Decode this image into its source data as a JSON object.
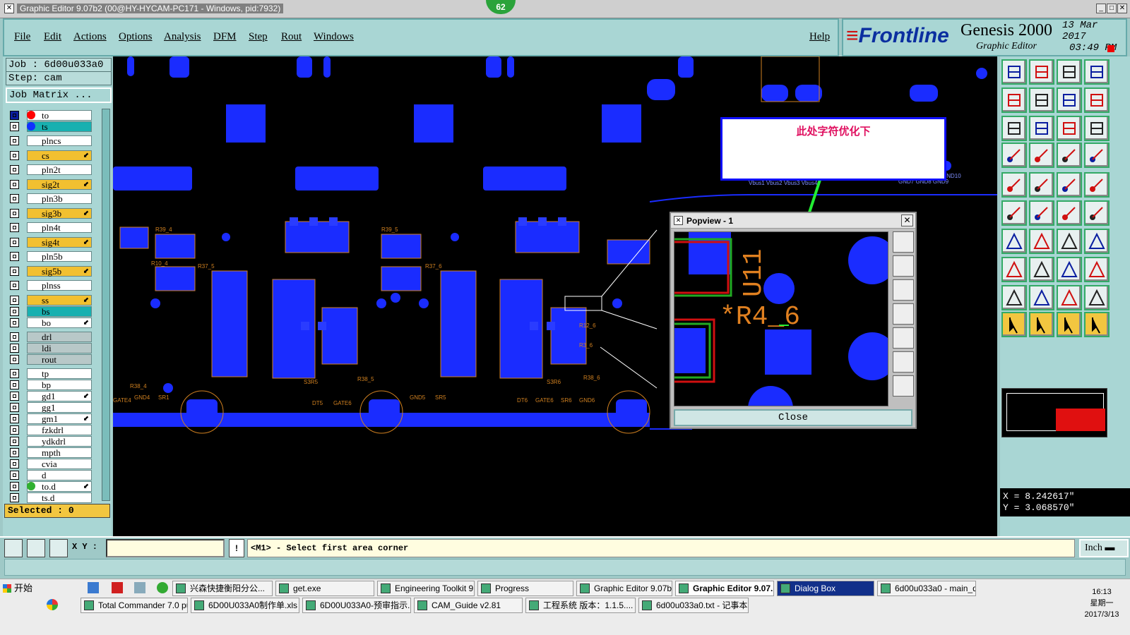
{
  "window": {
    "title": "Graphic Editor 9.07b2 (00@HY-HYCAM-PC171 - Windows, pid:7932)",
    "badge": "62"
  },
  "menu": {
    "items": [
      "File",
      "Edit",
      "Actions",
      "Options",
      "Analysis",
      "DFM",
      "Step",
      "Rout",
      "Windows"
    ],
    "help": "Help"
  },
  "brand": {
    "logo_main": "Frontline",
    "product": "Genesis 2000",
    "subtitle": "Graphic Editor",
    "date": "13 Mar 2017",
    "time": "03:49 PM"
  },
  "job": {
    "job_label": "Job : 6d00u033a0",
    "step_label": "Step: cam",
    "matrix_button": "Job Matrix ..."
  },
  "layers": [
    {
      "name": "to",
      "color": "#ffffff",
      "dot": "#ff0000",
      "sel": true
    },
    {
      "name": "ts",
      "color": "#18b0b0",
      "dot": "#1030ff",
      "sel": false
    },
    {
      "name": "plncs",
      "color": "#ffffff",
      "dot": "",
      "sel": false
    },
    {
      "name": "cs",
      "color": "#f2c030",
      "dot": "",
      "sel": false
    },
    {
      "name": "pln2t",
      "color": "#ffffff",
      "dot": "",
      "sel": false
    },
    {
      "name": "sig2t",
      "color": "#f2c030",
      "dot": "",
      "sel": false
    },
    {
      "name": "pln3b",
      "color": "#ffffff",
      "dot": "",
      "sel": false
    },
    {
      "name": "sig3b",
      "color": "#f2c030",
      "dot": "",
      "sel": false
    },
    {
      "name": "pln4t",
      "color": "#ffffff",
      "dot": "",
      "sel": false
    },
    {
      "name": "sig4t",
      "color": "#f2c030",
      "dot": "",
      "sel": false
    },
    {
      "name": "pln5b",
      "color": "#ffffff",
      "dot": "",
      "sel": false
    },
    {
      "name": "sig5b",
      "color": "#f2c030",
      "dot": "",
      "sel": false
    },
    {
      "name": "plnss",
      "color": "#ffffff",
      "dot": "",
      "sel": false
    },
    {
      "name": "ss",
      "color": "#f2c030",
      "dot": "",
      "sel": false
    },
    {
      "name": "bs",
      "color": "#18b0b0",
      "dot": "",
      "sel": false
    },
    {
      "name": "bo",
      "color": "#ffffff",
      "dot": "",
      "sel": false
    },
    {
      "name": "drl",
      "color": "#b8c8c8",
      "dot": "",
      "sel": false
    },
    {
      "name": "ldi",
      "color": "#b8c8c8",
      "dot": "",
      "sel": false
    },
    {
      "name": "rout",
      "color": "#b8c8c8",
      "dot": "",
      "sel": false
    },
    {
      "name": "tp",
      "color": "#ffffff",
      "dot": "",
      "sel": false
    },
    {
      "name": "bp",
      "color": "#ffffff",
      "dot": "",
      "sel": false
    },
    {
      "name": "gd1",
      "color": "#ffffff",
      "dot": "",
      "sel": false
    },
    {
      "name": "gg1",
      "color": "#ffffff",
      "dot": "",
      "sel": false
    },
    {
      "name": "gm1",
      "color": "#ffffff",
      "dot": "",
      "sel": false
    },
    {
      "name": "fzkdrl",
      "color": "#ffffff",
      "dot": "",
      "sel": false
    },
    {
      "name": "ydkdrl",
      "color": "#ffffff",
      "dot": "",
      "sel": false
    },
    {
      "name": "mpth",
      "color": "#ffffff",
      "dot": "",
      "sel": false
    },
    {
      "name": "cvia",
      "color": "#ffffff",
      "dot": "",
      "sel": false
    },
    {
      "name": "d",
      "color": "#ffffff",
      "dot": "",
      "sel": false
    },
    {
      "name": "to.d",
      "color": "#ffffff",
      "dot": "#30b030",
      "sel": false
    },
    {
      "name": "ts.d",
      "color": "#ffffff",
      "dot": "",
      "sel": false
    }
  ],
  "selected": "Selected : 0",
  "coords": {
    "x": "X = 8.242617\"",
    "y": "Y = 3.068570\""
  },
  "cmd": {
    "xy_label": "X Y :",
    "prompt": "<M1> - Select first area corner",
    "unit": "Inch"
  },
  "popview": {
    "title": "Popview - 1",
    "close": "Close",
    "label_r": "*R4_6",
    "label_u": "U11"
  },
  "callout": {
    "text": "此处字符优化下"
  },
  "canvas_labels": {
    "vbus": "Vbus1  Vbus2 Vbus3 Vbus4",
    "gnd": "GND7 GND8 GND9",
    "gnd10": "GND10"
  },
  "taskbar": {
    "start": "开始",
    "row1": [
      "兴森快捷衡阳分公...",
      "get.exe",
      "Engineering Toolkit 9....",
      "Progress",
      "Graphic Editor 9.07b2...",
      "Graphic Editor 9.07...",
      "Dialog Box",
      "6d00u033a0 - main_qa"
    ],
    "row2": [
      "Total Commander 7.0 pu...",
      "6D00U033A0制作单.xls ...",
      "6D00U033A0-预审指示...",
      "CAM_Guide v2.81",
      "工程系统  版本：1.1.5....",
      "6d00u033a0.txt - 记事本"
    ],
    "clock": "16:13",
    "weekday": "星期一",
    "date": "2017/3/13"
  }
}
